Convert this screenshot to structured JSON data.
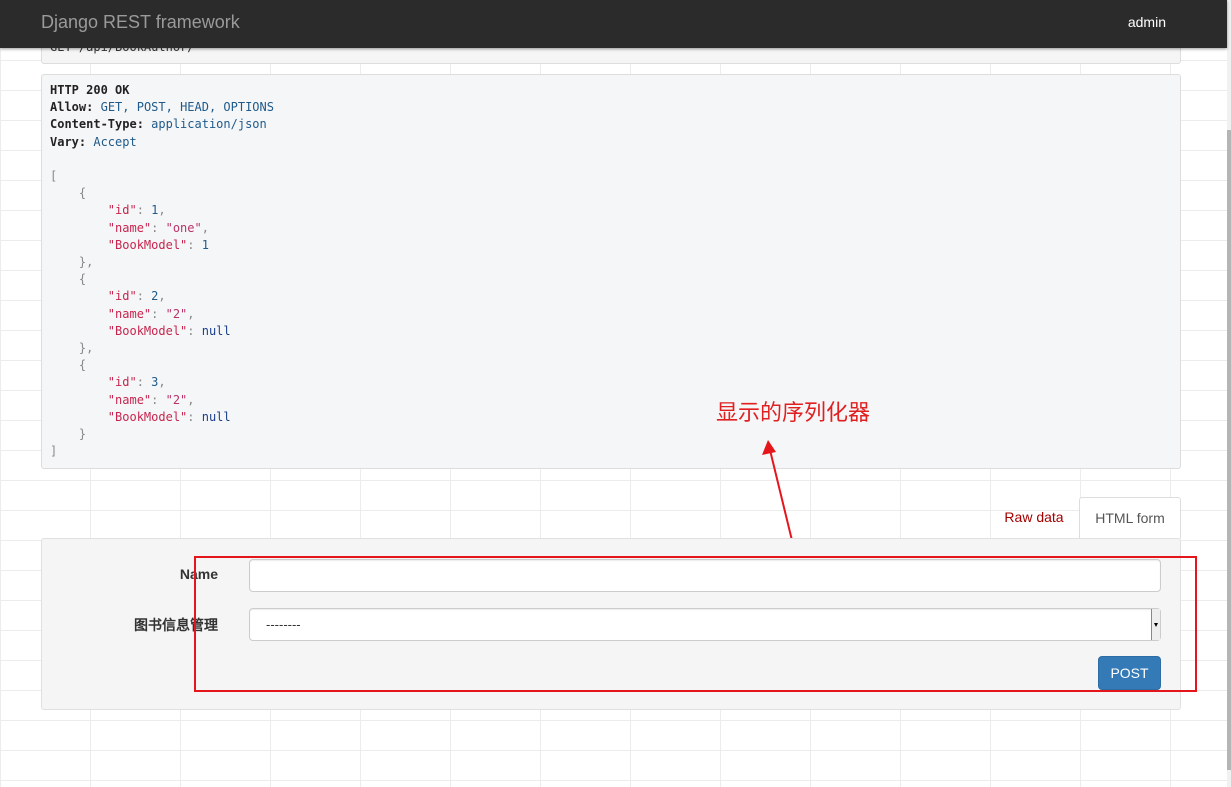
{
  "navbar": {
    "brand": "Django REST framework",
    "user": "admin"
  },
  "request": {
    "line": "GET /api/BookAuthor/"
  },
  "response": {
    "status": "HTTP 200 OK",
    "headers": [
      {
        "key": "Allow:",
        "value": "GET, POST, HEAD, OPTIONS"
      },
      {
        "key": "Content-Type:",
        "value": "application/json"
      },
      {
        "key": "Vary:",
        "value": "Accept"
      }
    ],
    "body": [
      {
        "id": 1,
        "name": "one",
        "BookModel": 1
      },
      {
        "id": 2,
        "name": "2",
        "BookModel": null
      },
      {
        "id": 3,
        "name": "2",
        "BookModel": null
      }
    ]
  },
  "annotation": {
    "text": "显示的序列化器",
    "color": "#e02020"
  },
  "tabs": {
    "raw_label": "Raw data",
    "html_label": "HTML form"
  },
  "form": {
    "name_label": "Name",
    "name_value": "",
    "book_label": "图书信息管理",
    "book_selected": "--------",
    "submit_label": "POST"
  },
  "colors": {
    "navbar": "#2b2b2b",
    "primary": "#337ab7",
    "highlight": "#e4161c",
    "link": "#a30000"
  }
}
